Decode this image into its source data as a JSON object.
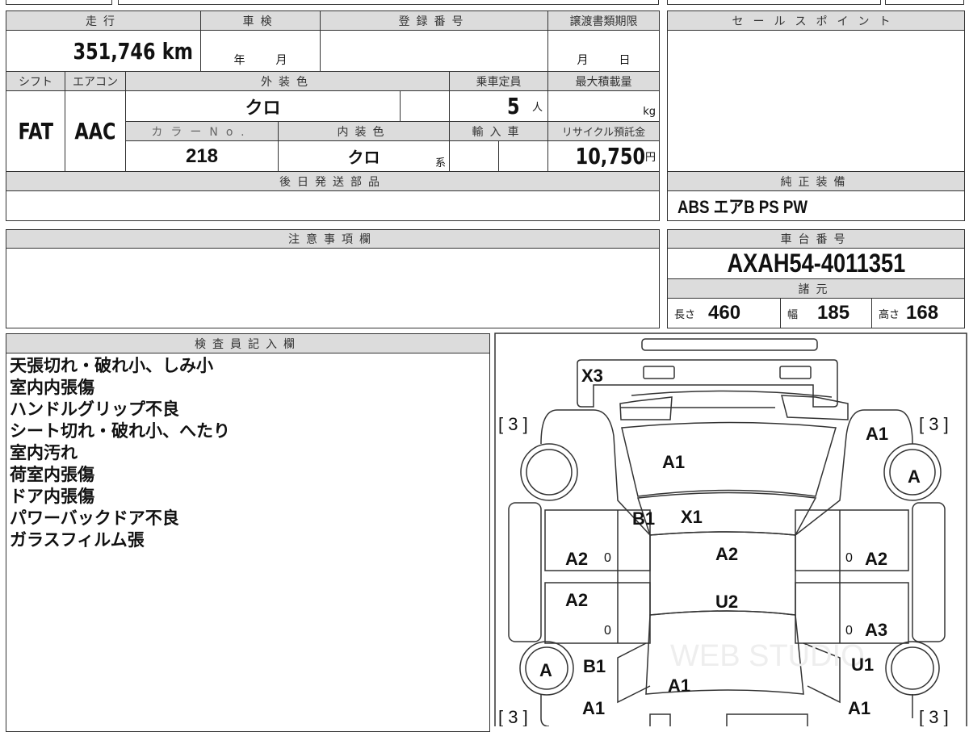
{
  "sheet": {
    "mileage": {
      "label": "走行",
      "value": "351,746",
      "unit": "km"
    },
    "inspection": {
      "label": "車検",
      "year": "年",
      "month": "月"
    },
    "registration": {
      "label": "登録番号",
      "value": ""
    },
    "transfer_deadline": {
      "label": "譲渡書類期限",
      "month": "月",
      "day": "日"
    },
    "shift": {
      "label": "シフト",
      "value": "FAT"
    },
    "aircon": {
      "label": "エアコン",
      "value": "AAC"
    },
    "exterior_color": {
      "label": "外装色",
      "value": "クロ"
    },
    "capacity": {
      "label": "乗車定員",
      "value": "5",
      "unit": "人"
    },
    "max_load": {
      "label": "最大積載量",
      "unit": "kg"
    },
    "color_no": {
      "label": "カラーNo.",
      "value": "218"
    },
    "interior_color": {
      "label": "内装色",
      "value": "クロ",
      "suffix": "系"
    },
    "import": {
      "label": "輸入車"
    },
    "recycle": {
      "label": "リサイクル預託金",
      "value": "10,750",
      "unit": "円"
    },
    "later_parts": {
      "label": "後日発送部品"
    },
    "notes": {
      "label": "注意事項欄"
    },
    "sales_point": {
      "label": "セールスポイント"
    },
    "equipment": {
      "label": "純正装備",
      "value": "ABS エアB PS PW"
    },
    "chassis": {
      "label": "車台番号",
      "value": "AXAH54-4011351"
    },
    "specs": {
      "label": "諸元",
      "length_label": "長さ",
      "length": "460",
      "width_label": "幅",
      "width": "185",
      "height_label": "高さ",
      "height": "168"
    },
    "inspector": {
      "label": "検査員記入欄",
      "lines": [
        "天張切れ・破れ小、しみ小",
        "室内内張傷",
        "ハンドルグリップ不良",
        "シート切れ・破れ小、へたり",
        "室内汚れ",
        "荷室内張傷",
        "ドア内張傷",
        "パワーバックドア不良",
        "ガラスフィルム張"
      ]
    }
  },
  "diagram": {
    "marks": [
      "X3",
      "[ 3 ]",
      "[ 3 ]",
      "A1",
      "A1",
      "A",
      "B1",
      "X1",
      "A2",
      "A2",
      "A2",
      "0",
      "0",
      "0",
      "0",
      "A2",
      "U2",
      "A3",
      "A",
      "B1",
      "U1",
      "A1",
      "A1",
      "A1",
      "[ 3 ]",
      "[ 3 ]"
    ],
    "watermark": "WEB STUDIO"
  }
}
